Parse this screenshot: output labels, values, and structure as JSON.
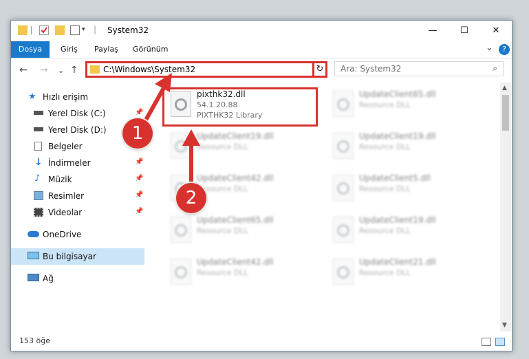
{
  "window": {
    "title": "System32",
    "controls": {
      "minimize": "—",
      "maximize": "☐",
      "close": "✕"
    }
  },
  "ribbon": {
    "tabs": [
      "Dosya",
      "Giriş",
      "Paylaş",
      "Görünüm"
    ],
    "active_tab": "Dosya",
    "expand_label": "⌄",
    "help_label": "?"
  },
  "navigation": {
    "back": "←",
    "forward": "→",
    "recent": "⌄",
    "up": "↑",
    "address_path": "C:\\Windows\\System32",
    "address_dropdown": "⌄",
    "refresh": "↻",
    "search_placeholder": "Ara: System32",
    "search_icon": "⌕"
  },
  "sidebar": {
    "items": [
      {
        "label": "Hızlı erişim",
        "icon": "star-icon",
        "pinned": false
      },
      {
        "label": "Yerel Disk (C:)",
        "icon": "drive-icon",
        "pinned": true
      },
      {
        "label": "Yerel Disk (D:)",
        "icon": "drive-icon",
        "pinned": false
      },
      {
        "label": "Belgeler",
        "icon": "documents-icon",
        "pinned": true
      },
      {
        "label": "İndirmeler",
        "icon": "download-icon",
        "pinned": true
      },
      {
        "label": "Müzik",
        "icon": "music-icon",
        "pinned": true
      },
      {
        "label": "Resimler",
        "icon": "pictures-icon",
        "pinned": true
      },
      {
        "label": "Videolar",
        "icon": "videos-icon",
        "pinned": true
      },
      {
        "label": "OneDrive",
        "icon": "cloud-icon",
        "pinned": false
      },
      {
        "label": "Bu bilgisayar",
        "icon": "computer-icon",
        "pinned": false
      },
      {
        "label": "Ağ",
        "icon": "network-icon",
        "pinned": false
      }
    ],
    "pin_glyph": "📌"
  },
  "files": [
    {
      "name": "pixthk32.dll",
      "line2": "54.1.20.88",
      "line3": "PIXTHK32 Library",
      "highlighted": true
    },
    {
      "name": "UpdateClient65.dll",
      "line2": "Resource DLL"
    },
    {
      "name": "UpdateClient19.dll",
      "line2": "Resource DLL"
    },
    {
      "name": "UpdateClient19.dll",
      "line2": "Resource DLL"
    },
    {
      "name": "UpdateClient42.dll",
      "line2": "Resource DLL"
    },
    {
      "name": "UpdateClient5.dll",
      "line2": "Resource DLL"
    },
    {
      "name": "UpdateClient65.dll",
      "line2": "Resource DLL"
    },
    {
      "name": "UpdateClient19.dll",
      "line2": "Resource DLL"
    },
    {
      "name": "UpdateClient42.dll",
      "line2": "Resource DLL"
    },
    {
      "name": "UpdateClient21.dll",
      "line2": "Resource DLL"
    }
  ],
  "status": {
    "item_count": "153 öğe"
  },
  "annotations": {
    "step1": "1",
    "step2": "2"
  },
  "colors": {
    "accent": "#1979ca",
    "highlight": "#d7322e",
    "selected": "#cce4f7"
  }
}
